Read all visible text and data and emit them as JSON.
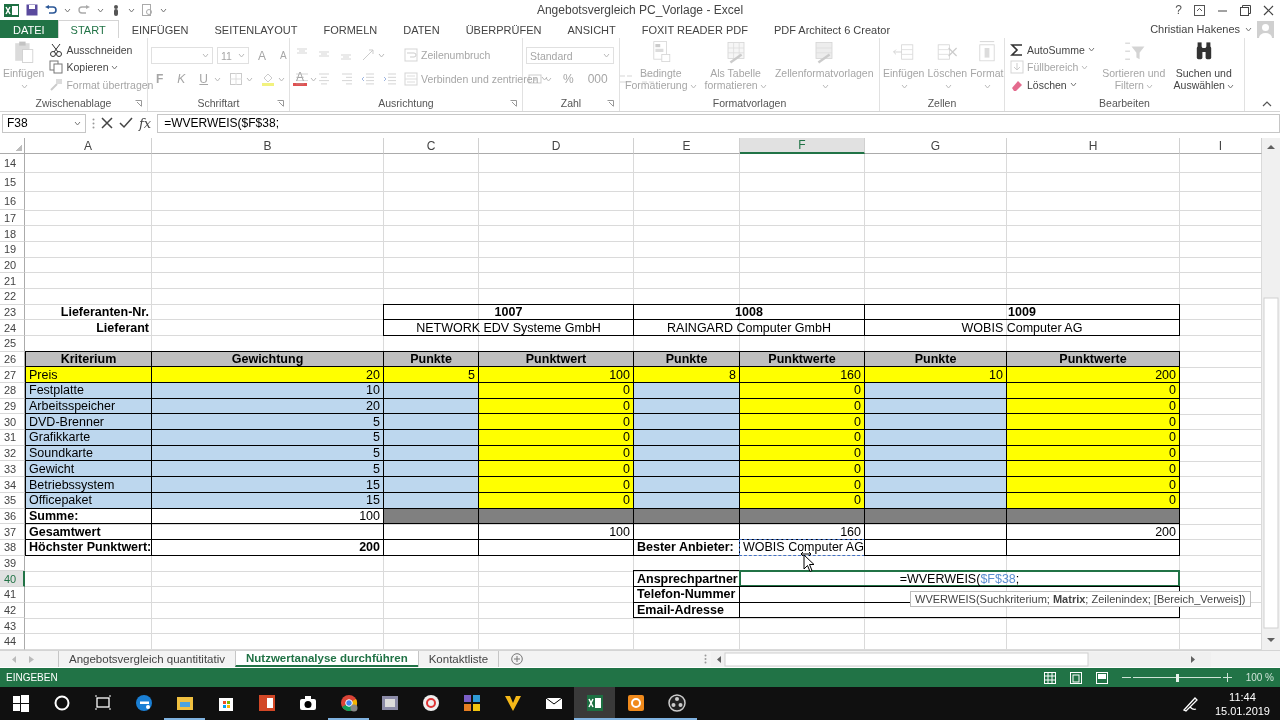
{
  "window": {
    "title": "Angebotsvergleich PC_Vorlage - Excel",
    "help": "?"
  },
  "user": "Christian Hakenes",
  "menu_tabs": [
    {
      "label": "DATEI",
      "kind": "file",
      "selected": false
    },
    {
      "label": "START",
      "kind": "tab",
      "selected": true
    },
    {
      "label": "EINFÜGEN",
      "kind": "tab",
      "selected": false
    },
    {
      "label": "SEITENLAYOUT",
      "kind": "tab",
      "selected": false
    },
    {
      "label": "FORMELN",
      "kind": "tab",
      "selected": false
    },
    {
      "label": "DATEN",
      "kind": "tab",
      "selected": false
    },
    {
      "label": "ÜBERPRÜFEN",
      "kind": "tab",
      "selected": false
    },
    {
      "label": "ANSICHT",
      "kind": "tab",
      "selected": false
    },
    {
      "label": "FOXIT READER PDF",
      "kind": "tab",
      "selected": false
    },
    {
      "label": "PDF Architect 6 Creator",
      "kind": "tab",
      "selected": false
    }
  ],
  "ribbon": [
    {
      "title": "Zwischenablage",
      "launcher": true,
      "columns": [
        {
          "kind": "paste",
          "label": "Einfügen",
          "disabled": true,
          "dropdown": true
        },
        {
          "kind": "stack",
          "rows": [
            [
              {
                "kind": "cut",
                "label": "Ausschneiden",
                "disabled": false
              }
            ],
            [
              {
                "kind": "copy",
                "label": "Kopieren",
                "disabled": false,
                "dropdown": true
              }
            ],
            [
              {
                "kind": "brush",
                "label": "Format übertragen",
                "disabled": true
              }
            ]
          ]
        }
      ]
    },
    {
      "title": "Schriftart",
      "launcher": true,
      "columns": [
        {
          "kind": "stack",
          "rows": [
            [
              {
                "kind": "field",
                "disabled": true,
                "dropdown": true
              },
              {
                "kind": "field",
                "value": "11",
                "disabled": true,
                "dropdown": true
              },
              {
                "kind": "grow",
                "label": "A",
                "disabled": true
              },
              {
                "kind": "shrink",
                "label": "A",
                "disabled": true
              }
            ],
            [
              {
                "kind": "bold",
                "label": "F",
                "disabled": true
              },
              {
                "kind": "italic",
                "label": "K",
                "disabled": true
              },
              {
                "kind": "underline",
                "label": "U",
                "disabled": true,
                "dropdown": true
              },
              {
                "kind": "borders",
                "disabled": true,
                "dropdown": true
              },
              {
                "kind": "fillcolor",
                "disabled": true,
                "dropdown": true
              },
              {
                "kind": "fontcolor",
                "label": "A",
                "disabled": true,
                "dropdown": true
              }
            ]
          ]
        }
      ]
    },
    {
      "title": "Ausrichtung",
      "launcher": true,
      "columns": [
        {
          "kind": "stack",
          "rows": [
            [
              {
                "kind": "aligntop",
                "disabled": true
              },
              {
                "kind": "alignmiddle",
                "disabled": true
              },
              {
                "kind": "alignbottom",
                "disabled": true
              },
              {
                "kind": "orient",
                "disabled": true,
                "dropdown": true
              }
            ],
            [
              {
                "kind": "alignleft",
                "disabled": true
              },
              {
                "kind": "aligncenter",
                "disabled": true
              },
              {
                "kind": "alignright",
                "disabled": true
              },
              {
                "kind": "outdent",
                "disabled": true
              },
              {
                "kind": "indent",
                "disabled": true
              }
            ]
          ]
        },
        {
          "kind": "stack",
          "rows": [
            [
              {
                "kind": "wrap",
                "label": "Zeilenumbruch",
                "disabled": true
              }
            ],
            [
              {
                "kind": "merge",
                "label": "Verbinden und zentrieren",
                "disabled": true,
                "dropdown": true
              }
            ]
          ]
        }
      ]
    },
    {
      "title": "Zahl",
      "launcher": true,
      "columns": [
        {
          "kind": "stack",
          "rows": [
            [
              {
                "kind": "field",
                "value": "Standard",
                "disabled": true,
                "dropdown": true
              }
            ],
            [
              {
                "kind": "currency",
                "disabled": true,
                "dropdown": true
              },
              {
                "kind": "letter",
                "label": "%",
                "disabled": true
              },
              {
                "kind": "letter",
                "label": "000",
                "disabled": true
              },
              {
                "kind": "decinc",
                "disabled": true
              },
              {
                "kind": "decdec",
                "disabled": true
              }
            ]
          ]
        }
      ]
    },
    {
      "title": "Formatvorlagen",
      "launcher": false,
      "columns": [
        {
          "kind": "conditional",
          "label": "Bedingte Formatierung",
          "disabled": true,
          "dropdown": true
        },
        {
          "kind": "table",
          "label": "Als Tabelle formatieren",
          "disabled": true,
          "dropdown": true
        },
        {
          "kind": "styles",
          "label": "Zellenformatvorlagen",
          "disabled": true,
          "dropdown": true
        }
      ]
    },
    {
      "title": "Zellen",
      "launcher": false,
      "columns": [
        {
          "kind": "insert",
          "label": "Einfügen",
          "disabled": true,
          "dropdown": true
        },
        {
          "kind": "delete",
          "label": "Löschen",
          "disabled": true,
          "dropdown": true
        },
        {
          "kind": "format",
          "label": "Format",
          "disabled": true,
          "dropdown": true
        }
      ]
    },
    {
      "title": "Bearbeiten",
      "launcher": false,
      "columns": [
        {
          "kind": "stack",
          "rows": [
            [
              {
                "kind": "sum",
                "label": "AutoSumme",
                "disabled": false,
                "dropdown": true
              }
            ],
            [
              {
                "kind": "fill",
                "label": "Füllbereich",
                "disabled": true,
                "dropdown": true
              }
            ],
            [
              {
                "kind": "eraser",
                "label": "Löschen",
                "disabled": false,
                "dropdown": true
              }
            ]
          ]
        },
        {
          "kind": "sort",
          "label": "Sortieren und Filtern",
          "disabled": true,
          "dropdown": true
        },
        {
          "kind": "find",
          "label": "Suchen und Auswählen",
          "disabled": false,
          "dropdown": true
        }
      ]
    }
  ],
  "formula_bar": {
    "name_box": "F38",
    "fx": "fx",
    "formula": "=WVERWEIS($F$38;"
  },
  "columns": [
    {
      "label": "A",
      "selected": false
    },
    {
      "label": "B",
      "selected": false
    },
    {
      "label": "C",
      "selected": false
    },
    {
      "label": "D",
      "selected": false
    },
    {
      "label": "E",
      "selected": false
    },
    {
      "label": "F",
      "selected": true
    },
    {
      "label": "G",
      "selected": false
    },
    {
      "label": "H",
      "selected": false
    },
    {
      "label": "I",
      "selected": false
    }
  ],
  "rows": [
    {
      "number": "14",
      "selected": false
    },
    {
      "number": "15",
      "selected": false
    },
    {
      "number": "16",
      "selected": false
    },
    {
      "number": "17",
      "selected": false
    },
    {
      "number": "18",
      "selected": false
    },
    {
      "number": "19",
      "selected": false
    },
    {
      "number": "20",
      "selected": false
    },
    {
      "number": "21",
      "selected": false
    },
    {
      "number": "22",
      "selected": false
    },
    {
      "number": "23",
      "selected": false,
      "cells": [
        {
          "kind": "caption",
          "text": "Lieferanten-Nr."
        },
        {
          "kind": "blank"
        },
        {
          "kind": "heading",
          "text": "1007"
        },
        {
          "kind": "heading",
          "text": "1008"
        },
        {
          "kind": "heading",
          "text": "1009"
        }
      ]
    },
    {
      "number": "24",
      "selected": false,
      "cells": [
        {
          "kind": "caption",
          "text": "Lieferant"
        },
        {
          "kind": "blank"
        },
        {
          "kind": "name",
          "text": "NETWORK EDV Systeme GmbH"
        },
        {
          "kind": "name",
          "text": "RAINGARD Computer GmbH"
        },
        {
          "kind": "name",
          "text": "WOBIS Computer AG"
        }
      ]
    },
    {
      "number": "25",
      "selected": false
    },
    {
      "number": "26",
      "selected": false,
      "cells": [
        {
          "kind": "heading",
          "text": "Kriterium",
          "color": "#bfbfbf"
        },
        {
          "kind": "heading",
          "text": "Gewichtung",
          "color": "#bfbfbf"
        },
        {
          "kind": "heading",
          "text": "Punkte",
          "color": "#bfbfbf"
        },
        {
          "kind": "heading",
          "text": "Punktwert",
          "color": "#bfbfbf"
        },
        {
          "kind": "heading",
          "text": "Punkte",
          "color": "#bfbfbf"
        },
        {
          "kind": "heading",
          "text": "Punktwerte",
          "color": "#bfbfbf"
        },
        {
          "kind": "heading",
          "text": "Punkte",
          "color": "#bfbfbf"
        },
        {
          "kind": "heading",
          "text": "Punktwerte",
          "color": "#bfbfbf"
        }
      ]
    },
    {
      "number": "27",
      "selected": false,
      "cells": [
        {
          "kind": "text",
          "text": "Preis",
          "color": "#ffff00"
        },
        {
          "kind": "value",
          "text": "20",
          "color": "#ffff00"
        },
        {
          "kind": "value",
          "text": "5",
          "color": "#ffff00"
        },
        {
          "kind": "value",
          "text": "100",
          "color": "#ffff00"
        },
        {
          "kind": "value",
          "text": "8",
          "color": "#ffff00"
        },
        {
          "kind": "value",
          "text": "160",
          "color": "#ffff00"
        },
        {
          "kind": "value",
          "text": "10",
          "color": "#ffff00"
        },
        {
          "kind": "value",
          "text": "200",
          "color": "#ffff00"
        }
      ]
    },
    {
      "number": "28",
      "selected": false,
      "cells": [
        {
          "kind": "text",
          "text": "Festplatte",
          "color": "#bdd7ee"
        },
        {
          "kind": "value",
          "text": "10",
          "color": "#bdd7ee"
        },
        {
          "kind": "empty",
          "color": "#bdd7ee"
        },
        {
          "kind": "value",
          "text": "0",
          "color": "#ffff00"
        },
        {
          "kind": "empty",
          "color": "#bdd7ee"
        },
        {
          "kind": "value",
          "text": "0",
          "color": "#ffff00"
        },
        {
          "kind": "empty",
          "color": "#bdd7ee"
        },
        {
          "kind": "value",
          "text": "0",
          "color": "#ffff00"
        }
      ]
    },
    {
      "number": "29",
      "selected": false,
      "cells": [
        {
          "kind": "text",
          "text": "Arbeitsspeicher",
          "color": "#bdd7ee"
        },
        {
          "kind": "value",
          "text": "20",
          "color": "#bdd7ee"
        },
        {
          "kind": "empty",
          "color": "#bdd7ee"
        },
        {
          "kind": "value",
          "text": "0",
          "color": "#ffff00"
        },
        {
          "kind": "empty",
          "color": "#bdd7ee"
        },
        {
          "kind": "value",
          "text": "0",
          "color": "#ffff00"
        },
        {
          "kind": "empty",
          "color": "#bdd7ee"
        },
        {
          "kind": "value",
          "text": "0",
          "color": "#ffff00"
        }
      ]
    },
    {
      "number": "30",
      "selected": false,
      "cells": [
        {
          "kind": "text",
          "text": "DVD-Brenner",
          "color": "#bdd7ee"
        },
        {
          "kind": "value",
          "text": "5",
          "color": "#bdd7ee"
        },
        {
          "kind": "empty",
          "color": "#bdd7ee"
        },
        {
          "kind": "value",
          "text": "0",
          "color": "#ffff00"
        },
        {
          "kind": "empty",
          "color": "#bdd7ee"
        },
        {
          "kind": "value",
          "text": "0",
          "color": "#ffff00"
        },
        {
          "kind": "empty",
          "color": "#bdd7ee"
        },
        {
          "kind": "value",
          "text": "0",
          "color": "#ffff00"
        }
      ]
    },
    {
      "number": "31",
      "selected": false,
      "cells": [
        {
          "kind": "text",
          "text": "Grafikkarte",
          "color": "#bdd7ee"
        },
        {
          "kind": "value",
          "text": "5",
          "color": "#bdd7ee"
        },
        {
          "kind": "empty",
          "color": "#bdd7ee"
        },
        {
          "kind": "value",
          "text": "0",
          "color": "#ffff00"
        },
        {
          "kind": "empty",
          "color": "#bdd7ee"
        },
        {
          "kind": "value",
          "text": "0",
          "color": "#ffff00"
        },
        {
          "kind": "empty",
          "color": "#bdd7ee"
        },
        {
          "kind": "value",
          "text": "0",
          "color": "#ffff00"
        }
      ]
    },
    {
      "number": "32",
      "selected": false,
      "cells": [
        {
          "kind": "text",
          "text": "Soundkarte",
          "color": "#bdd7ee"
        },
        {
          "kind": "value",
          "text": "5",
          "color": "#bdd7ee"
        },
        {
          "kind": "empty",
          "color": "#bdd7ee"
        },
        {
          "kind": "value",
          "text": "0",
          "color": "#ffff00"
        },
        {
          "kind": "empty",
          "color": "#bdd7ee"
        },
        {
          "kind": "value",
          "text": "0",
          "color": "#ffff00"
        },
        {
          "kind": "empty",
          "color": "#bdd7ee"
        },
        {
          "kind": "value",
          "text": "0",
          "color": "#ffff00"
        }
      ]
    },
    {
      "number": "33",
      "selected": false,
      "cells": [
        {
          "kind": "text",
          "text": "Gewicht",
          "color": "#bdd7ee"
        },
        {
          "kind": "value",
          "text": "5",
          "color": "#bdd7ee"
        },
        {
          "kind": "empty",
          "color": "#bdd7ee"
        },
        {
          "kind": "value",
          "text": "0",
          "color": "#ffff00"
        },
        {
          "kind": "empty",
          "color": "#bdd7ee"
        },
        {
          "kind": "value",
          "text": "0",
          "color": "#ffff00"
        },
        {
          "kind": "empty",
          "color": "#bdd7ee"
        },
        {
          "kind": "value",
          "text": "0",
          "color": "#ffff00"
        }
      ]
    },
    {
      "number": "34",
      "selected": false,
      "cells": [
        {
          "kind": "text",
          "text": "Betriebssystem",
          "color": "#bdd7ee"
        },
        {
          "kind": "value",
          "text": "15",
          "color": "#bdd7ee"
        },
        {
          "kind": "empty",
          "color": "#bdd7ee"
        },
        {
          "kind": "value",
          "text": "0",
          "color": "#ffff00"
        },
        {
          "kind": "empty",
          "color": "#bdd7ee"
        },
        {
          "kind": "value",
          "text": "0",
          "color": "#ffff00"
        },
        {
          "kind": "empty",
          "color": "#bdd7ee"
        },
        {
          "kind": "value",
          "text": "0",
          "color": "#ffff00"
        }
      ]
    },
    {
      "number": "35",
      "selected": false,
      "cells": [
        {
          "kind": "text",
          "text": "Officepaket",
          "color": "#bdd7ee"
        },
        {
          "kind": "value",
          "text": "15",
          "color": "#bdd7ee"
        },
        {
          "kind": "empty",
          "color": "#bdd7ee"
        },
        {
          "kind": "value",
          "text": "0",
          "color": "#ffff00"
        },
        {
          "kind": "empty",
          "color": "#bdd7ee"
        },
        {
          "kind": "value",
          "text": "0",
          "color": "#ffff00"
        },
        {
          "kind": "empty",
          "color": "#bdd7ee"
        },
        {
          "kind": "value",
          "text": "0",
          "color": "#ffff00"
        }
      ]
    },
    {
      "number": "36",
      "selected": false,
      "cells": [
        {
          "kind": "label",
          "text": "Summe:"
        },
        {
          "kind": "value",
          "text": "100"
        },
        {
          "kind": "empty",
          "color": "#808080"
        },
        {
          "kind": "empty",
          "color": "#808080"
        },
        {
          "kind": "empty",
          "color": "#808080"
        },
        {
          "kind": "empty",
          "color": "#808080"
        },
        {
          "kind": "empty",
          "color": "#808080"
        },
        {
          "kind": "empty",
          "color": "#808080"
        }
      ]
    },
    {
      "number": "37",
      "selected": false,
      "cells": [
        {
          "kind": "label",
          "text": "Gesamtwert"
        },
        {
          "kind": "empty"
        },
        {
          "kind": "empty"
        },
        {
          "kind": "value",
          "text": "100"
        },
        {
          "kind": "empty"
        },
        {
          "kind": "value",
          "text": "160"
        },
        {
          "kind": "empty"
        },
        {
          "kind": "value",
          "text": "200"
        }
      ]
    },
    {
      "number": "38",
      "selected": false,
      "cells": [
        {
          "kind": "label",
          "text": "Höchster Punktwert:"
        },
        {
          "kind": "strong",
          "text": "200"
        },
        {
          "kind": "empty"
        },
        {
          "kind": "empty"
        },
        {
          "kind": "label",
          "text": "Bester Anbieter:"
        },
        {
          "kind": "reference",
          "text": "WOBIS Computer AG"
        },
        {
          "kind": "empty"
        },
        {
          "kind": "empty"
        }
      ]
    },
    {
      "number": "39",
      "selected": false
    },
    {
      "number": "40",
      "selected": true,
      "cells": [
        {
          "kind": "blank"
        },
        {
          "kind": "blank"
        },
        {
          "kind": "blank"
        },
        {
          "kind": "blank"
        },
        {
          "kind": "label",
          "text": "Ansprechpartner"
        },
        {
          "kind": "editing",
          "parts": [
            {
              "text": "=WVERWEIS("
            },
            {
              "text": "$F$38",
              "color": "#5b8fd0"
            },
            {
              "text": ";"
            }
          ]
        }
      ]
    },
    {
      "number": "41",
      "selected": false,
      "cells": [
        {
          "kind": "blank"
        },
        {
          "kind": "blank"
        },
        {
          "kind": "blank"
        },
        {
          "kind": "blank"
        },
        {
          "kind": "label",
          "text": "Telefon-Nummer"
        },
        {
          "kind": "empty"
        }
      ]
    },
    {
      "number": "42",
      "selected": false,
      "cells": [
        {
          "kind": "blank"
        },
        {
          "kind": "blank"
        },
        {
          "kind": "blank"
        },
        {
          "kind": "blank"
        },
        {
          "kind": "label",
          "text": "Email-Adresse"
        },
        {
          "kind": "empty"
        }
      ]
    },
    {
      "number": "43",
      "selected": false
    },
    {
      "number": "44",
      "selected": false
    }
  ],
  "tooltip": "WVERWEIS(Suchkriterium; **Matrix**; Zeilenindex; [Bereich_Verweis])",
  "sheet_tabs": [
    {
      "label": "Angebotsvergleich quantititativ",
      "selected": false
    },
    {
      "label": "Nutzwertanalyse durchführen",
      "selected": true
    },
    {
      "label": "Kontaktliste",
      "selected": false
    }
  ],
  "status_bar": {
    "mode": "EINGEBEN",
    "zoom": "100 %",
    "zoom_slider": {
      "level": 0.5
    }
  },
  "taskbar": {
    "apps": [
      {
        "kind": "start",
        "open": false,
        "selected": false
      },
      {
        "kind": "cortana",
        "open": false,
        "selected": false
      },
      {
        "kind": "taskview",
        "open": false,
        "selected": false
      },
      {
        "kind": "edge",
        "open": false,
        "selected": false
      },
      {
        "kind": "explorer",
        "open": true,
        "selected": false
      },
      {
        "kind": "store",
        "open": false,
        "selected": false
      },
      {
        "kind": "powerpoint",
        "open": false,
        "selected": false
      },
      {
        "kind": "camera",
        "open": false,
        "selected": false
      },
      {
        "kind": "chrome",
        "open": true,
        "selected": false
      },
      {
        "kind": "video",
        "open": false,
        "selected": false
      },
      {
        "kind": "ring",
        "open": false,
        "selected": false
      },
      {
        "kind": "puzzle",
        "open": false,
        "selected": false
      },
      {
        "kind": "vee",
        "open": false,
        "selected": false
      },
      {
        "kind": "mail",
        "open": false,
        "selected": false
      },
      {
        "kind": "excel",
        "open": true,
        "selected": true
      },
      {
        "kind": "orange",
        "open": true,
        "selected": false
      },
      {
        "kind": "obs",
        "open": true,
        "selected": false
      }
    ],
    "clock": {
      "time": "11:44",
      "date": "15.01.2019"
    }
  }
}
